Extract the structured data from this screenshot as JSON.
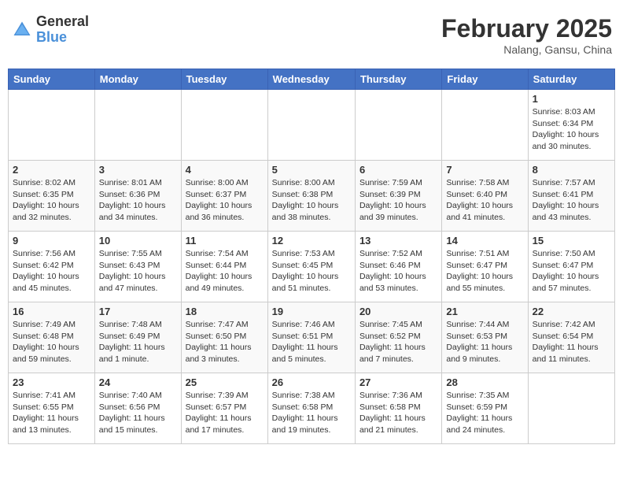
{
  "header": {
    "logo_general": "General",
    "logo_blue": "Blue",
    "month_title": "February 2025",
    "location": "Nalang, Gansu, China"
  },
  "days_of_week": [
    "Sunday",
    "Monday",
    "Tuesday",
    "Wednesday",
    "Thursday",
    "Friday",
    "Saturday"
  ],
  "weeks": [
    [
      {
        "day": "",
        "info": ""
      },
      {
        "day": "",
        "info": ""
      },
      {
        "day": "",
        "info": ""
      },
      {
        "day": "",
        "info": ""
      },
      {
        "day": "",
        "info": ""
      },
      {
        "day": "",
        "info": ""
      },
      {
        "day": "1",
        "info": "Sunrise: 8:03 AM\nSunset: 6:34 PM\nDaylight: 10 hours\nand 30 minutes."
      }
    ],
    [
      {
        "day": "2",
        "info": "Sunrise: 8:02 AM\nSunset: 6:35 PM\nDaylight: 10 hours\nand 32 minutes."
      },
      {
        "day": "3",
        "info": "Sunrise: 8:01 AM\nSunset: 6:36 PM\nDaylight: 10 hours\nand 34 minutes."
      },
      {
        "day": "4",
        "info": "Sunrise: 8:00 AM\nSunset: 6:37 PM\nDaylight: 10 hours\nand 36 minutes."
      },
      {
        "day": "5",
        "info": "Sunrise: 8:00 AM\nSunset: 6:38 PM\nDaylight: 10 hours\nand 38 minutes."
      },
      {
        "day": "6",
        "info": "Sunrise: 7:59 AM\nSunset: 6:39 PM\nDaylight: 10 hours\nand 39 minutes."
      },
      {
        "day": "7",
        "info": "Sunrise: 7:58 AM\nSunset: 6:40 PM\nDaylight: 10 hours\nand 41 minutes."
      },
      {
        "day": "8",
        "info": "Sunrise: 7:57 AM\nSunset: 6:41 PM\nDaylight: 10 hours\nand 43 minutes."
      }
    ],
    [
      {
        "day": "9",
        "info": "Sunrise: 7:56 AM\nSunset: 6:42 PM\nDaylight: 10 hours\nand 45 minutes."
      },
      {
        "day": "10",
        "info": "Sunrise: 7:55 AM\nSunset: 6:43 PM\nDaylight: 10 hours\nand 47 minutes."
      },
      {
        "day": "11",
        "info": "Sunrise: 7:54 AM\nSunset: 6:44 PM\nDaylight: 10 hours\nand 49 minutes."
      },
      {
        "day": "12",
        "info": "Sunrise: 7:53 AM\nSunset: 6:45 PM\nDaylight: 10 hours\nand 51 minutes."
      },
      {
        "day": "13",
        "info": "Sunrise: 7:52 AM\nSunset: 6:46 PM\nDaylight: 10 hours\nand 53 minutes."
      },
      {
        "day": "14",
        "info": "Sunrise: 7:51 AM\nSunset: 6:47 PM\nDaylight: 10 hours\nand 55 minutes."
      },
      {
        "day": "15",
        "info": "Sunrise: 7:50 AM\nSunset: 6:47 PM\nDaylight: 10 hours\nand 57 minutes."
      }
    ],
    [
      {
        "day": "16",
        "info": "Sunrise: 7:49 AM\nSunset: 6:48 PM\nDaylight: 10 hours\nand 59 minutes."
      },
      {
        "day": "17",
        "info": "Sunrise: 7:48 AM\nSunset: 6:49 PM\nDaylight: 11 hours\nand 1 minute."
      },
      {
        "day": "18",
        "info": "Sunrise: 7:47 AM\nSunset: 6:50 PM\nDaylight: 11 hours\nand 3 minutes."
      },
      {
        "day": "19",
        "info": "Sunrise: 7:46 AM\nSunset: 6:51 PM\nDaylight: 11 hours\nand 5 minutes."
      },
      {
        "day": "20",
        "info": "Sunrise: 7:45 AM\nSunset: 6:52 PM\nDaylight: 11 hours\nand 7 minutes."
      },
      {
        "day": "21",
        "info": "Sunrise: 7:44 AM\nSunset: 6:53 PM\nDaylight: 11 hours\nand 9 minutes."
      },
      {
        "day": "22",
        "info": "Sunrise: 7:42 AM\nSunset: 6:54 PM\nDaylight: 11 hours\nand 11 minutes."
      }
    ],
    [
      {
        "day": "23",
        "info": "Sunrise: 7:41 AM\nSunset: 6:55 PM\nDaylight: 11 hours\nand 13 minutes."
      },
      {
        "day": "24",
        "info": "Sunrise: 7:40 AM\nSunset: 6:56 PM\nDaylight: 11 hours\nand 15 minutes."
      },
      {
        "day": "25",
        "info": "Sunrise: 7:39 AM\nSunset: 6:57 PM\nDaylight: 11 hours\nand 17 minutes."
      },
      {
        "day": "26",
        "info": "Sunrise: 7:38 AM\nSunset: 6:58 PM\nDaylight: 11 hours\nand 19 minutes."
      },
      {
        "day": "27",
        "info": "Sunrise: 7:36 AM\nSunset: 6:58 PM\nDaylight: 11 hours\nand 21 minutes."
      },
      {
        "day": "28",
        "info": "Sunrise: 7:35 AM\nSunset: 6:59 PM\nDaylight: 11 hours\nand 24 minutes."
      },
      {
        "day": "",
        "info": ""
      }
    ]
  ]
}
